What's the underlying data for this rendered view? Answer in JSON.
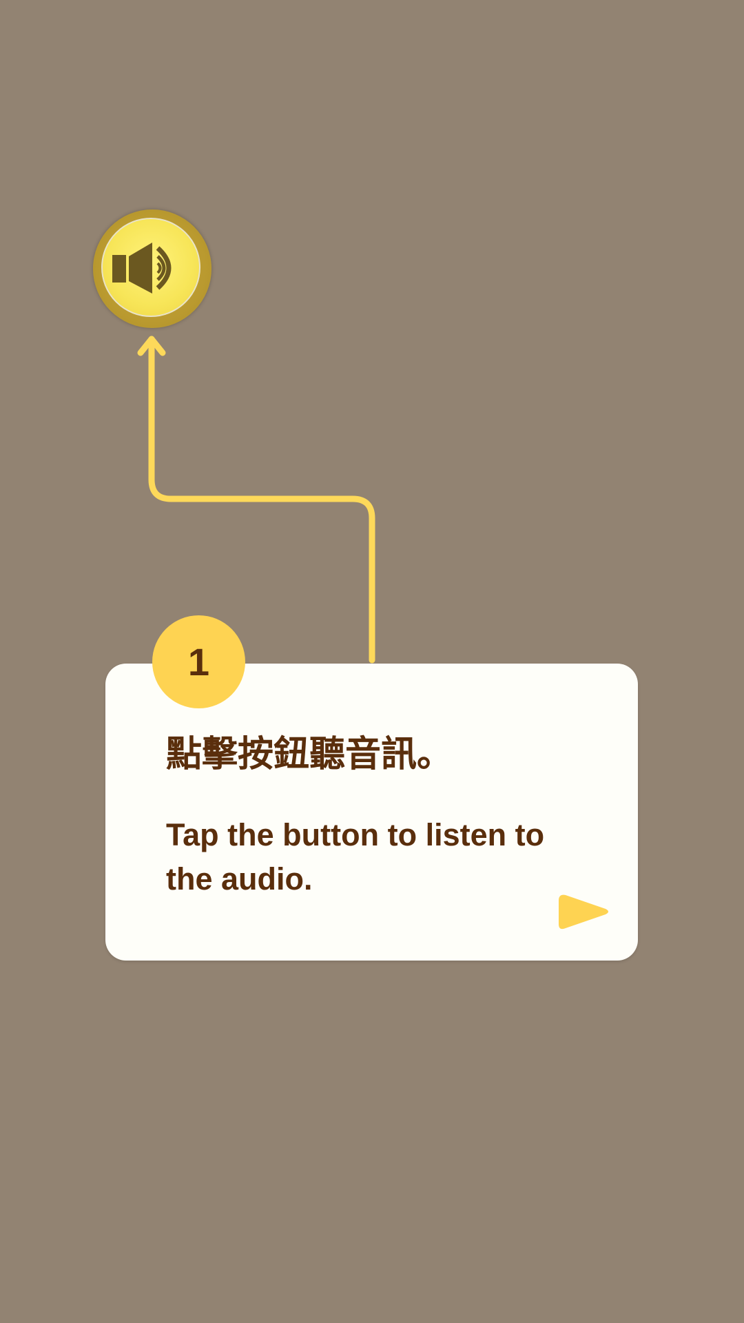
{
  "tutorial": {
    "step_number": "1",
    "instruction_zh": "點擊按鈕聽音訊。",
    "instruction_en": "Tap the button to listen to the audio."
  },
  "icons": {
    "speaker": "speaker-icon",
    "next": "play-arrow-icon"
  },
  "colors": {
    "background": "#928372",
    "accent": "#fed352",
    "text": "#5a2e0c",
    "card": "#fefef9"
  }
}
